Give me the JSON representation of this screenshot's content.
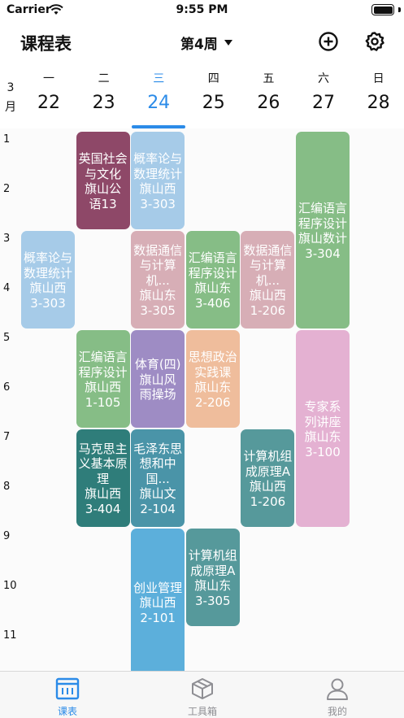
{
  "status_bar": {
    "carrier": "Carrier",
    "time": "9:55 PM"
  },
  "nav": {
    "title": "课程表",
    "week_label": "第4周"
  },
  "header": {
    "month": "3\n月",
    "days": [
      {
        "weekday": "一",
        "date": "22"
      },
      {
        "weekday": "二",
        "date": "23"
      },
      {
        "weekday": "三",
        "date": "24",
        "today": true
      },
      {
        "weekday": "四",
        "date": "25"
      },
      {
        "weekday": "五",
        "date": "26"
      },
      {
        "weekday": "六",
        "date": "27"
      },
      {
        "weekday": "日",
        "date": "28"
      }
    ]
  },
  "periods": [
    "1",
    "2",
    "3",
    "4",
    "5",
    "6",
    "7",
    "8",
    "9",
    "10",
    "11"
  ],
  "courses": [
    {
      "day": 2,
      "start": 1,
      "length": 2,
      "lines": [
        "英国社会",
        "与文化",
        "旗山公",
        "语13"
      ],
      "color": "#8e4868"
    },
    {
      "day": 3,
      "start": 1,
      "length": 2,
      "lines": [
        "概率论与",
        "数理统计",
        "旗山西",
        "3-303"
      ],
      "color": "#a6cbe8"
    },
    {
      "day": 6,
      "start": 1,
      "length": 4,
      "lines": [
        "汇编语言",
        "程序设计",
        "旗山数计",
        "3-304"
      ],
      "color": "#86bd86"
    },
    {
      "day": 1,
      "start": 3,
      "length": 2,
      "lines": [
        "概率论与",
        "数理统计",
        "旗山西",
        "3-303"
      ],
      "color": "#a6cbe8"
    },
    {
      "day": 3,
      "start": 3,
      "length": 2,
      "lines": [
        "数据通信",
        "与计算",
        "机...",
        "旗山东",
        "3-305"
      ],
      "color": "#d7aeb6"
    },
    {
      "day": 4,
      "start": 3,
      "length": 2,
      "lines": [
        "汇编语言",
        "程序设计",
        "旗山东",
        "3-406"
      ],
      "color": "#86bd86"
    },
    {
      "day": 5,
      "start": 3,
      "length": 2,
      "lines": [
        "数据通信",
        "与计算",
        "机...",
        "旗山西",
        "1-206"
      ],
      "color": "#d7aeb6"
    },
    {
      "day": 2,
      "start": 5,
      "length": 2,
      "lines": [
        "汇编语言",
        "程序设计",
        "旗山西",
        "1-105"
      ],
      "color": "#86bd86"
    },
    {
      "day": 3,
      "start": 5,
      "length": 2,
      "lines": [
        "体育(四)",
        "旗山风",
        "雨操场"
      ],
      "color": "#9e8cc4"
    },
    {
      "day": 4,
      "start": 5,
      "length": 2,
      "lines": [
        "思想政治",
        "实践课",
        "旗山东",
        "2-206"
      ],
      "color": "#efbd9c"
    },
    {
      "day": 6,
      "start": 5,
      "length": 4,
      "lines": [
        "专家系",
        "列讲座",
        "旗山东",
        "3-100"
      ],
      "color": "#e4b1d2"
    },
    {
      "day": 2,
      "start": 7,
      "length": 2,
      "lines": [
        "马克思主",
        "义基本原",
        "理",
        "旗山西",
        "3-404"
      ],
      "color": "#2f7d7a"
    },
    {
      "day": 3,
      "start": 7,
      "length": 2,
      "lines": [
        "毛泽东思",
        "想和中",
        "国...",
        "旗山文",
        "2-104"
      ],
      "color": "#4a94a8"
    },
    {
      "day": 5,
      "start": 7,
      "length": 2,
      "lines": [
        "计算机组",
        "成原理A",
        "旗山西",
        "1-206"
      ],
      "color": "#56999b"
    },
    {
      "day": 3,
      "start": 9,
      "length": 3,
      "lines": [
        "创业管理",
        "旗山西",
        "2-101"
      ],
      "color": "#5cafdb"
    },
    {
      "day": 4,
      "start": 9,
      "length": 2,
      "lines": [
        "计算机组",
        "成原理A",
        "旗山东",
        "3-305"
      ],
      "color": "#56999b"
    }
  ],
  "tabs": [
    {
      "label": "课表",
      "icon": "schedule-icon",
      "active": true
    },
    {
      "label": "工具箱",
      "icon": "toolbox-icon"
    },
    {
      "label": "我的",
      "icon": "profile-icon"
    }
  ],
  "colors": {
    "accent": "#2b8be8"
  }
}
